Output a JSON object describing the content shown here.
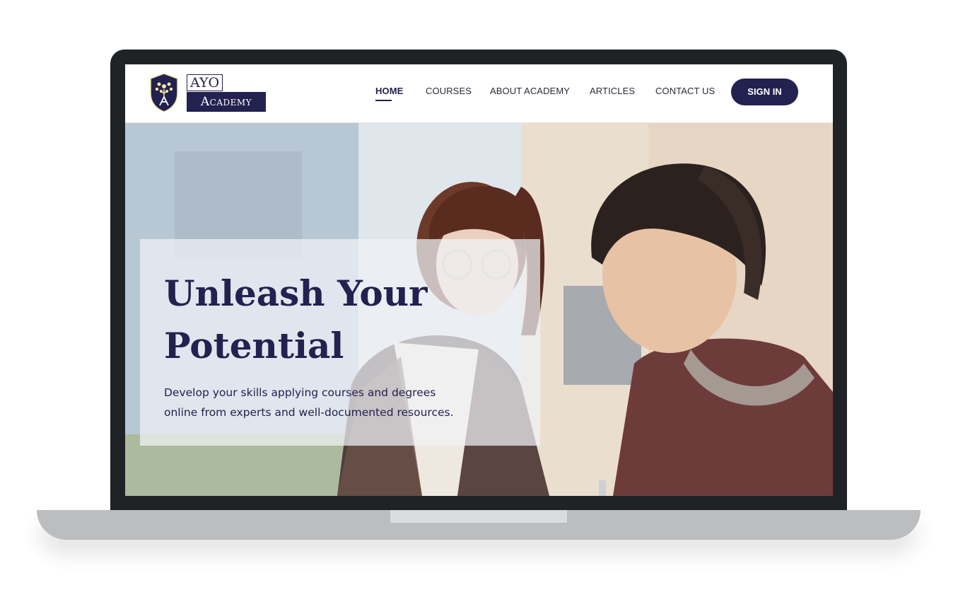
{
  "brand": {
    "name_top": "AYO",
    "name_bottom": "Academy",
    "primary_color": "#232150",
    "accent_color": "#f1e7a3"
  },
  "nav": {
    "links": [
      {
        "label": "HOME",
        "active": true
      },
      {
        "label": "COURSES",
        "active": false
      },
      {
        "label": "ABOUT ACADEMY",
        "active": false
      },
      {
        "label": "ARTICLES",
        "active": false
      },
      {
        "label": "CONTACT US",
        "active": false
      }
    ],
    "signin_label": "SIGN IN"
  },
  "hero": {
    "title_line1": "Unleash Your",
    "title_line2": "Potential",
    "subtitle_line1": "Develop your skills applying courses and degrees",
    "subtitle_line2": "online from experts and well-documented resources."
  }
}
